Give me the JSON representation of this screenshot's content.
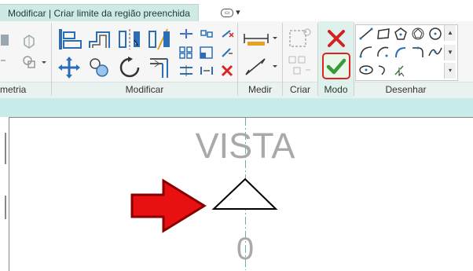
{
  "tabs": {
    "active_label": "Modificar | Criar limite da região preenchida",
    "toggle_label": "▾"
  },
  "ribbon": {
    "groups": {
      "geometria": "metria",
      "modificar": "Modificar",
      "medir": "Medir",
      "criar": "Criar",
      "modo": "Modo",
      "desenhar": "Desenhar"
    }
  },
  "view": {
    "title": "VISTA",
    "number": "0"
  },
  "colors": {
    "accent": "#cfe9e4",
    "finish_green": "#3a9a3a",
    "cancel_red": "#d22222",
    "highlight_frame": "#dd2222",
    "arrow_red": "#e81010",
    "view_text": "#a9a9a9"
  }
}
